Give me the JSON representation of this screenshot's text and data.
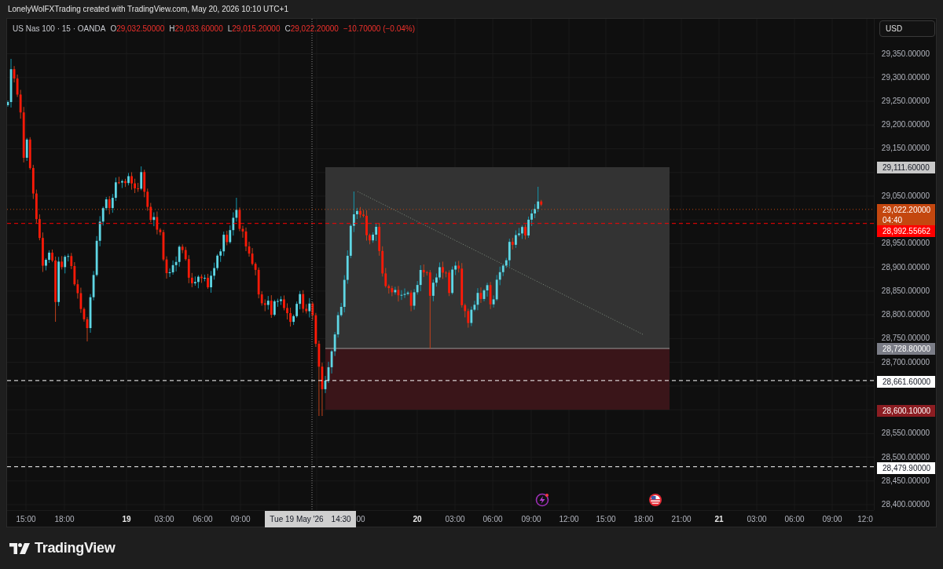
{
  "header": {
    "caption": "LonelyWolFXTrading created with TradingView.com, May 20, 2026 10:10 UTC+1"
  },
  "legend": {
    "symbol": "US Nas 100 · 15 · OANDA",
    "ohlc": [
      {
        "label": "O",
        "value": "29,032.50000"
      },
      {
        "label": "H",
        "value": "29,033.60000"
      },
      {
        "label": "L",
        "value": "29,015.20000"
      },
      {
        "label": "C",
        "value": "29,022.20000"
      }
    ],
    "change": "−10.70000 (−0.04%)"
  },
  "price_axis": {
    "currency": "USD",
    "ticks": [
      "29,350.00000",
      "29,300.00000",
      "29,250.00000",
      "29,200.00000",
      "29,150.00000",
      "29,050.00000",
      "28,950.00000",
      "28,900.00000",
      "28,850.00000",
      "28,800.00000",
      "28,750.00000",
      "28,700.00000",
      "28,550.00000",
      "28,500.00000",
      "28,450.00000",
      "28,400.00000"
    ],
    "labels": [
      {
        "text": "29,111.60000",
        "color": "#c8c8c8",
        "kind": "tag"
      },
      {
        "text": "29,022.20000",
        "countdown": "04:40",
        "color": "#c4470f",
        "kind": "dotted"
      },
      {
        "text": "28,992.55662",
        "color": "#ff0000",
        "kind": "dashed"
      },
      {
        "text": "28,728.80000",
        "color": "#7b7d87",
        "kind": "tag"
      },
      {
        "text": "28,661.60000",
        "color": "#ffffff",
        "kind": "dashed"
      },
      {
        "text": "28,600.10000",
        "color": "#8c1d22",
        "kind": "tag"
      },
      {
        "text": "28,479.90000",
        "color": "#ffffff",
        "kind": "dashed"
      }
    ]
  },
  "time_axis": {
    "ticks": [
      {
        "label": "15:00",
        "kind": "time"
      },
      {
        "label": "18:00",
        "kind": "time"
      },
      {
        "label": "19",
        "kind": "day"
      },
      {
        "label": "03:00",
        "kind": "time"
      },
      {
        "label": "06:00",
        "kind": "time"
      },
      {
        "label": "09:00",
        "kind": "time"
      },
      {
        "label": "00",
        "kind": "time"
      },
      {
        "label": "20",
        "kind": "day"
      },
      {
        "label": "03:00",
        "kind": "time"
      },
      {
        "label": "06:00",
        "kind": "time"
      },
      {
        "label": "09:00",
        "kind": "time"
      },
      {
        "label": "12:00",
        "kind": "time"
      },
      {
        "label": "15:00",
        "kind": "time"
      },
      {
        "label": "18:00",
        "kind": "time"
      },
      {
        "label": "21:00",
        "kind": "time"
      },
      {
        "label": "21",
        "kind": "day"
      },
      {
        "label": "03:00",
        "kind": "time"
      },
      {
        "label": "06:00",
        "kind": "time"
      },
      {
        "label": "09:00",
        "kind": "time"
      },
      {
        "label": "12:0",
        "kind": "time"
      }
    ],
    "crosshair": {
      "date": "Tue 19 May '26",
      "time": "14:30"
    }
  },
  "footer": {
    "brand": "TradingView"
  }
}
